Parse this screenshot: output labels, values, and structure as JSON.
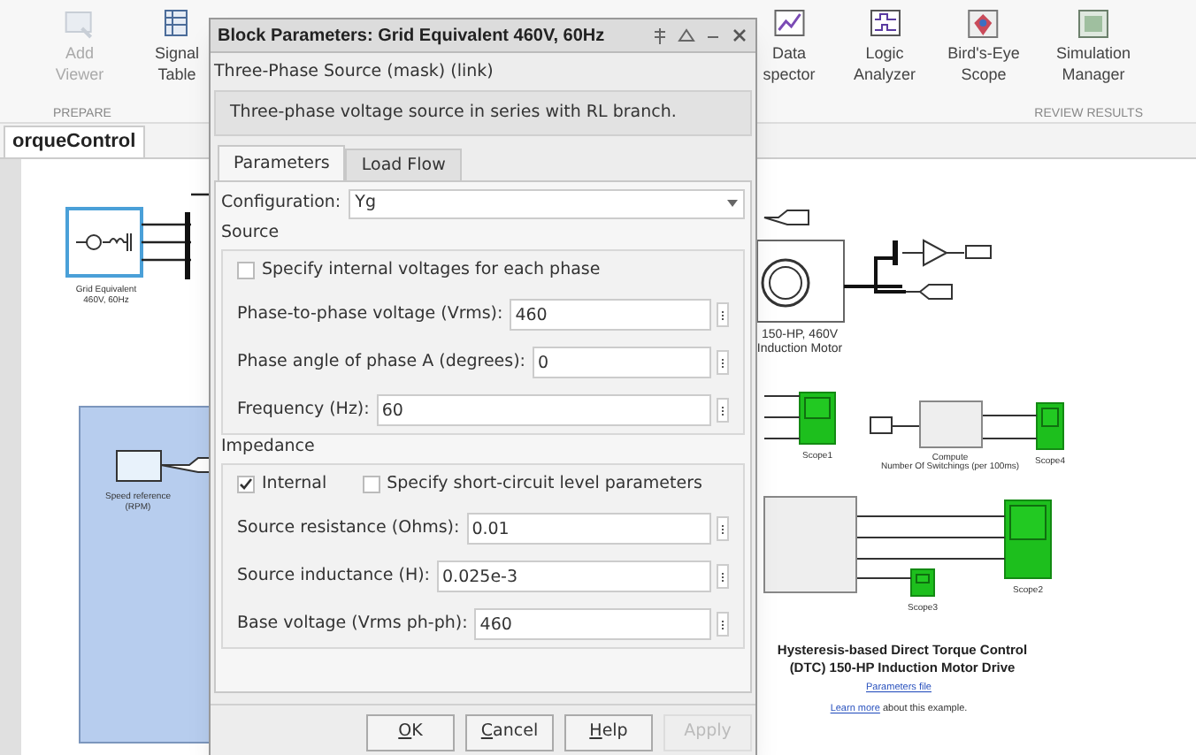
{
  "toolbar": {
    "items": [
      {
        "lines": [
          "Add",
          "Viewer"
        ],
        "disabled": true
      },
      {
        "lines": [
          "Signal",
          "Table"
        ],
        "disabled": false
      },
      {
        "lines": [
          "Data",
          "spector"
        ],
        "disabled": false
      },
      {
        "lines": [
          "Logic",
          "Analyzer"
        ],
        "disabled": false
      },
      {
        "lines": [
          "Bird's-Eye",
          "Scope"
        ],
        "disabled": false
      },
      {
        "lines": [
          "Simulation",
          "Manager"
        ],
        "disabled": false
      }
    ],
    "sections": [
      "PREPARE",
      "REVIEW RESULTS"
    ]
  },
  "model_tab": "orqueControl",
  "diagram": {
    "grid_block_label": [
      "Grid Equivalent",
      "460V, 60Hz"
    ],
    "speed_reference_label": [
      "Speed reference",
      "(RPM)"
    ],
    "motor_label": [
      "150-HP, 460V",
      "Induction Motor"
    ],
    "scope_labels": [
      "Scope1",
      "Scope4",
      "Scope2",
      "Scope3"
    ],
    "switching_label": [
      "Compute",
      "Number Of Switchings (per 100ms)"
    ],
    "title": [
      "Hysteresis-based Direct Torque Control",
      "(DTC) 150-HP Induction Motor Drive"
    ],
    "parameters_link": "Parameters file",
    "learn_more": {
      "link": "Learn more",
      "text": "about this example."
    }
  },
  "dialog": {
    "title": "Block Parameters: Grid Equivalent 460V, 60Hz",
    "subtitle": "Three-Phase Source (mask) (link)",
    "description": "Three-phase voltage source in series with RL branch.",
    "tabs": [
      {
        "label": "Parameters",
        "selected": true
      },
      {
        "label": "Load Flow",
        "selected": false
      }
    ],
    "configuration": {
      "label": "Configuration:",
      "value": "Yg"
    },
    "source": {
      "label": "Source",
      "checkboxes": [
        {
          "label": "Specify internal voltages for each phase",
          "checked": false
        }
      ],
      "fields": [
        {
          "label": "Phase-to-phase voltage (Vrms):",
          "value": "460"
        },
        {
          "label": "Phase angle of phase A (degrees):",
          "value": "0"
        },
        {
          "label": "Frequency (Hz):",
          "value": "60"
        }
      ]
    },
    "impedance": {
      "label": "Impedance",
      "checkboxes": [
        {
          "label": "Internal",
          "checked": true
        },
        {
          "label": "Specify short-circuit level parameters",
          "checked": false
        }
      ],
      "fields": [
        {
          "label": "Source resistance (Ohms):",
          "value": "0.01"
        },
        {
          "label": "Source inductance (H):",
          "value": "0.025e-3"
        },
        {
          "label": "Base voltage (Vrms ph-ph):",
          "value": "460"
        }
      ]
    },
    "buttons": [
      {
        "label": "OK",
        "disabled": false
      },
      {
        "label": "Cancel",
        "disabled": false
      },
      {
        "label": "Help",
        "disabled": false
      },
      {
        "label": "Apply",
        "disabled": true
      }
    ]
  }
}
